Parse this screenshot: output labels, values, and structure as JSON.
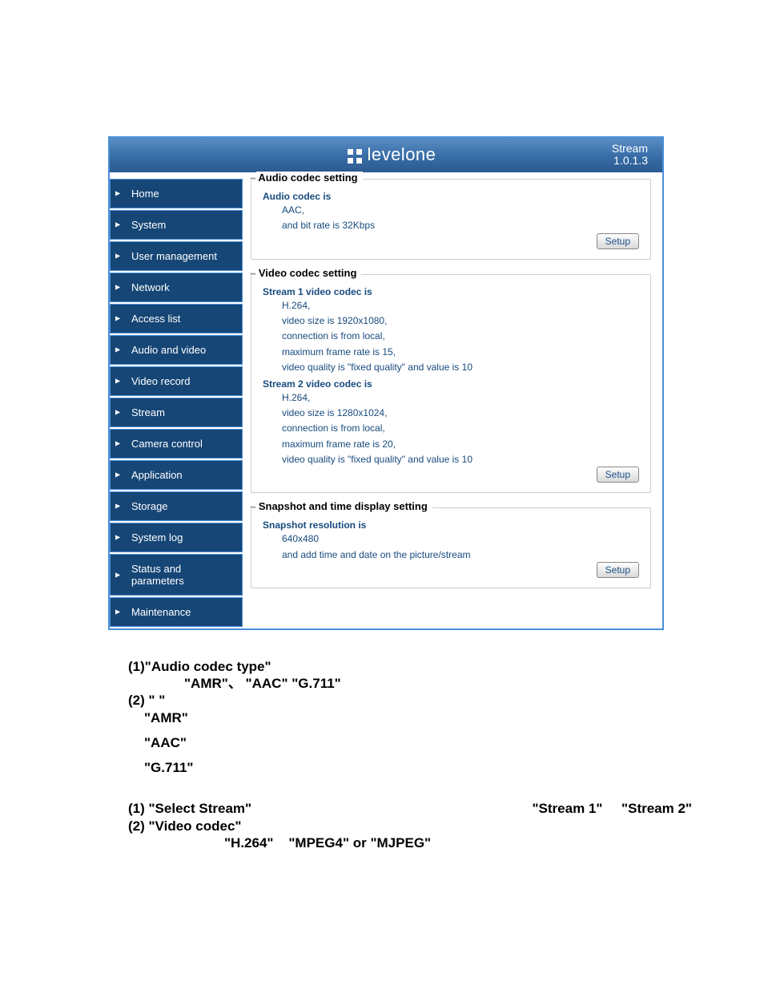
{
  "header": {
    "logo_name": "levelone",
    "page_name": "Stream",
    "version": "1.0.1.3"
  },
  "sidebar": {
    "items": [
      {
        "label": "Home"
      },
      {
        "label": "System"
      },
      {
        "label": "User management"
      },
      {
        "label": "Network"
      },
      {
        "label": "Access list"
      },
      {
        "label": "Audio and video"
      },
      {
        "label": "Video record"
      },
      {
        "label": "Stream"
      },
      {
        "label": "Camera control"
      },
      {
        "label": "Application"
      },
      {
        "label": "Storage"
      },
      {
        "label": "System log"
      },
      {
        "label": "Status and parameters"
      },
      {
        "label": "Maintenance"
      }
    ]
  },
  "main": {
    "audio": {
      "legend": "Audio codec setting",
      "heading": "Audio codec is",
      "codec": "AAC,",
      "bitrate": "and bit rate is 32Kbps",
      "setup": "Setup"
    },
    "video": {
      "legend": "Video codec setting",
      "stream1": {
        "heading": "Stream 1 video codec is",
        "codec": "H.264,",
        "size": "video size is 1920x1080,",
        "conn": "connection is from local,",
        "fps": "maximum frame rate is 15,",
        "quality": "video quality is \"fixed quality\" and value is 10"
      },
      "stream2": {
        "heading": "Stream 2 video codec is",
        "codec": "H.264,",
        "size": "video size is 1280x1024,",
        "conn": "connection is from local,",
        "fps": "maximum frame rate is 20,",
        "quality": "video quality is \"fixed quality\" and value is 10"
      },
      "setup": "Setup"
    },
    "snapshot": {
      "legend": "Snapshot and time display setting",
      "heading": "Snapshot resolution is",
      "res": "640x480",
      "note": "and add time and date on the picture/stream",
      "setup": "Setup"
    }
  },
  "doc": {
    "line1": "(1)\"Audio codec type\"",
    "line2": "\"AMR\"、 \"AAC\"      \"G.711\"",
    "line3": "(2) \"          \"",
    "line4": "\"AMR\"",
    "line5": "\"AAC\"",
    "line6": "\"G.711\"",
    "line7": "(1) \"Select Stream\"",
    "line7b": "\"Stream 1\"     \"Stream 2\"",
    "line8": "(2) \"Video codec\"",
    "line9": "\"H.264\"    \"MPEG4\" or \"MJPEG\""
  }
}
